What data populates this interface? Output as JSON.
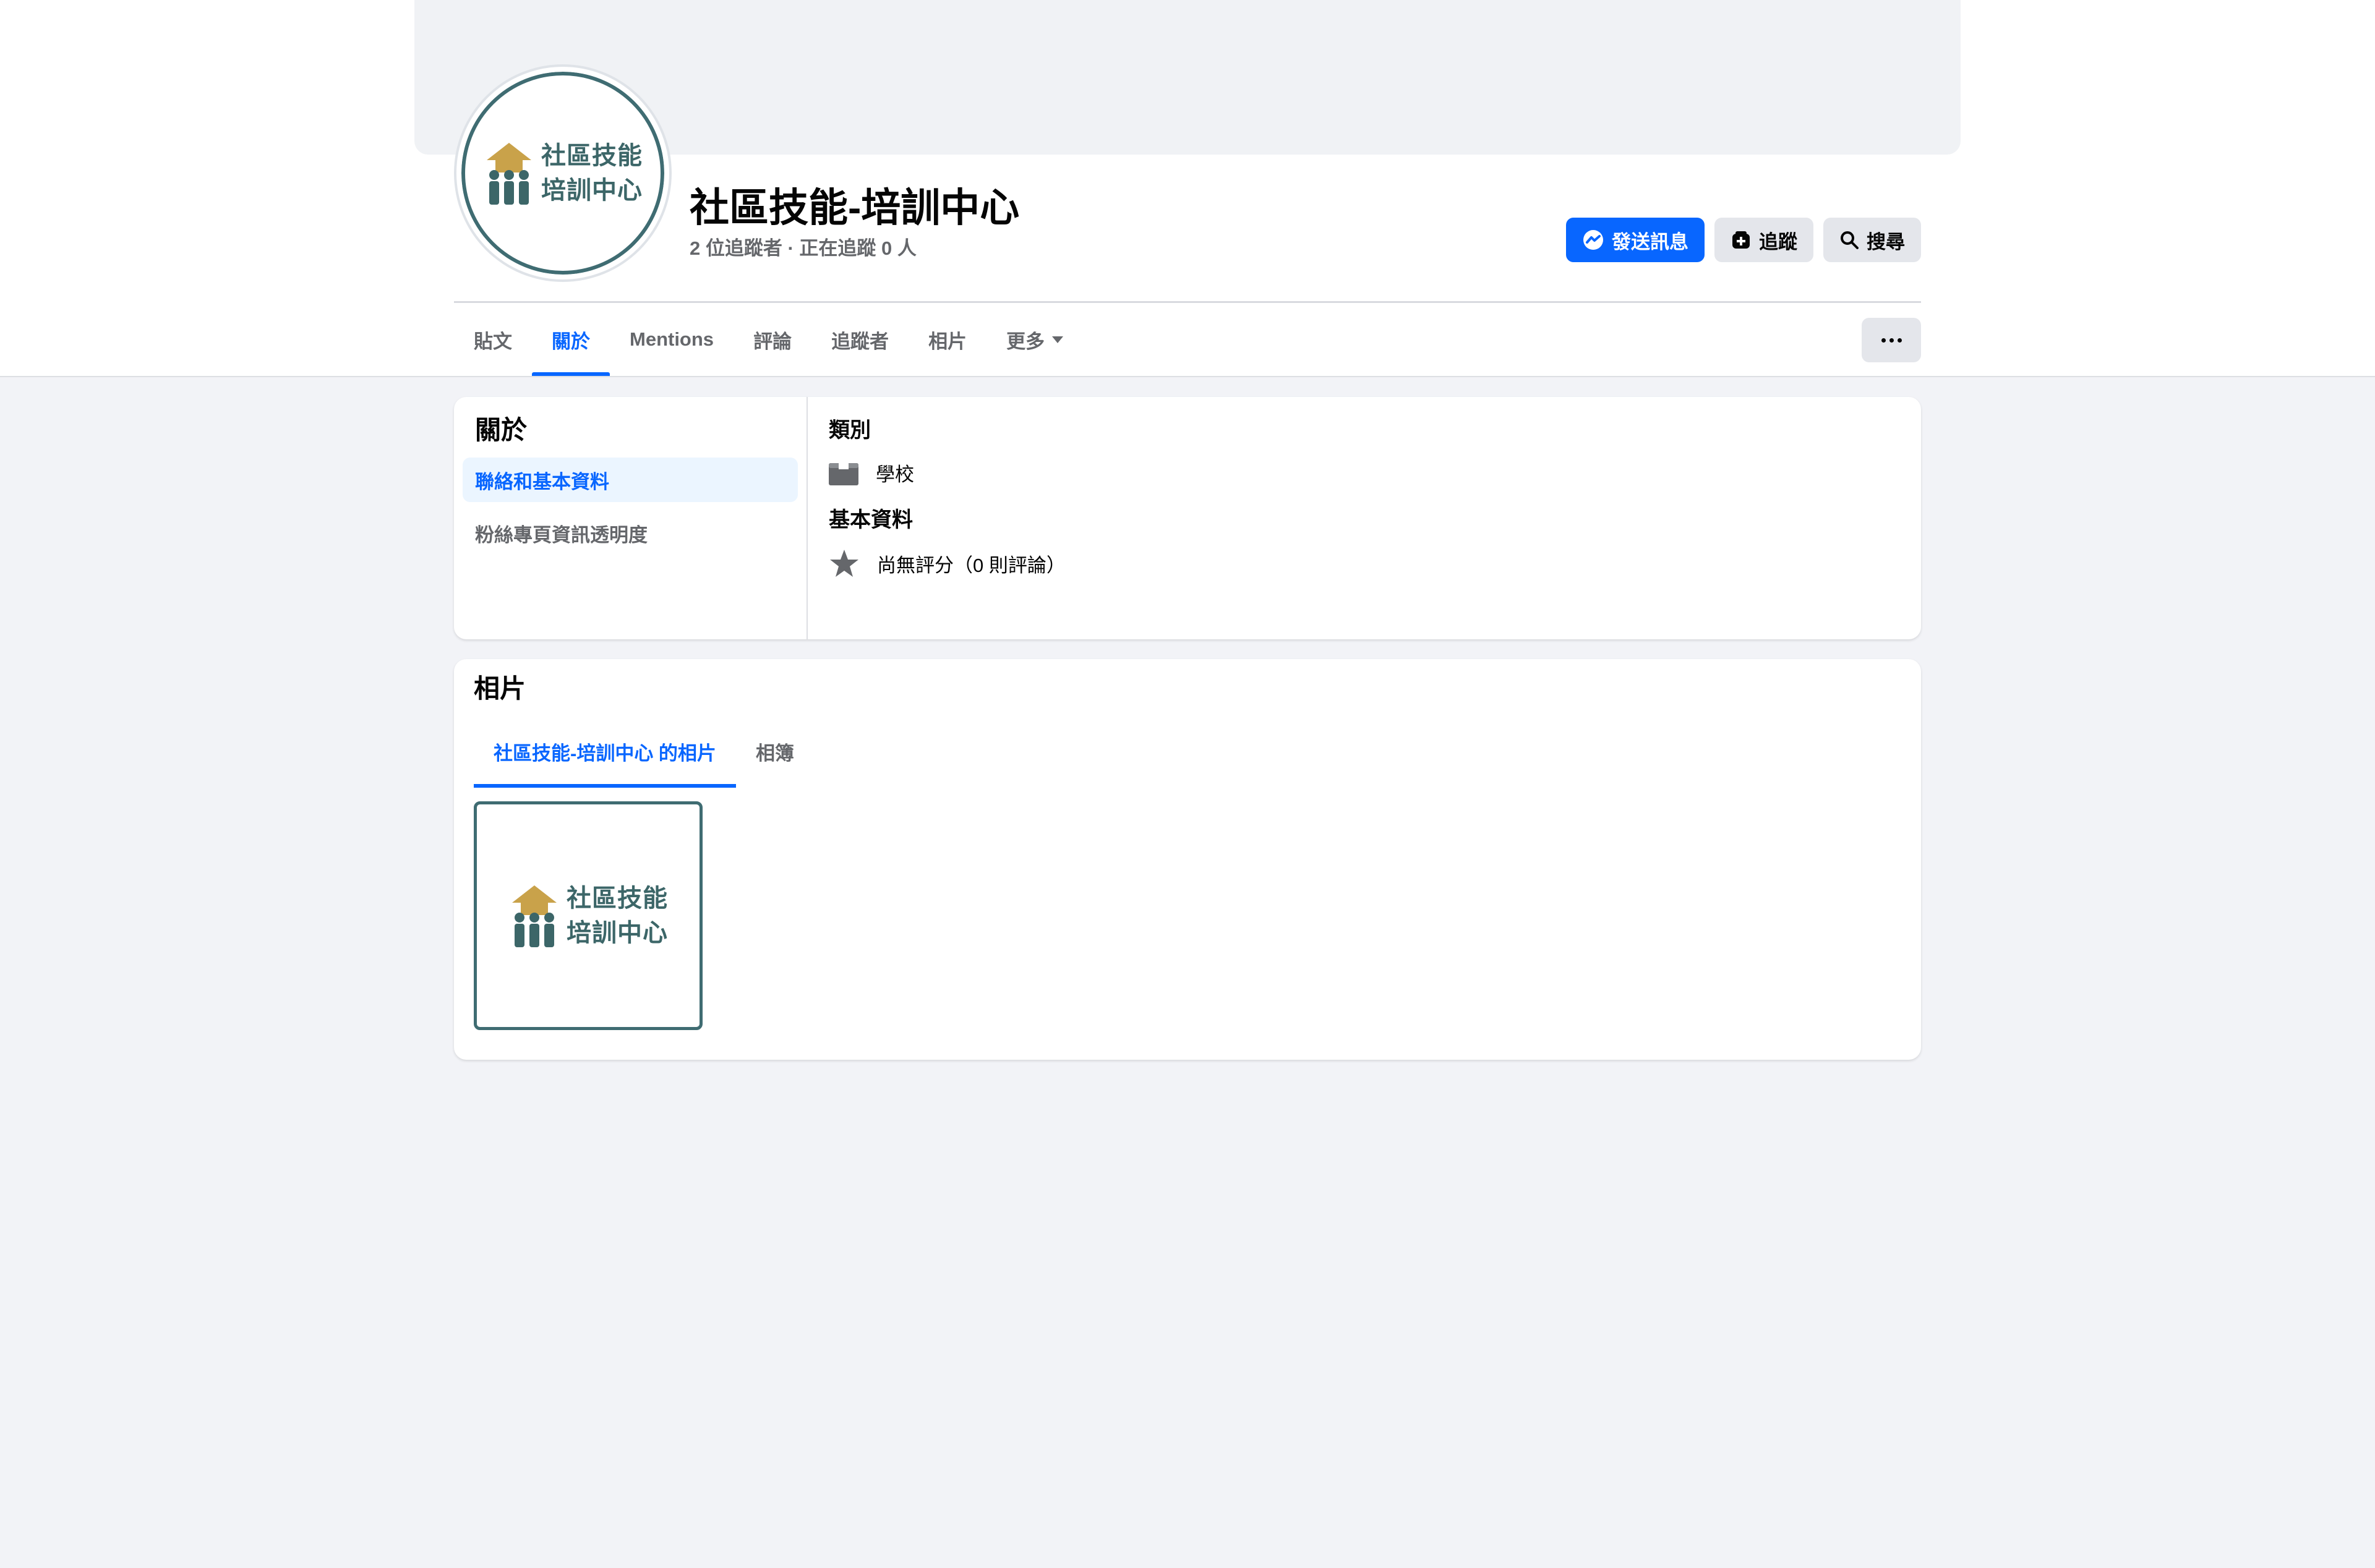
{
  "page": {
    "title": "社區技能-培訓中心",
    "followers": "2 位追蹤者 · 正在追蹤 0 人",
    "logo_lines": [
      "社區技能",
      "培訓中心"
    ]
  },
  "actions": {
    "message": "發送訊息",
    "follow": "追蹤",
    "search": "搜尋"
  },
  "tabs": [
    {
      "label": "貼文"
    },
    {
      "label": "關於"
    },
    {
      "label": "Mentions"
    },
    {
      "label": "評論"
    },
    {
      "label": "追蹤者"
    },
    {
      "label": "相片"
    },
    {
      "label": "更多"
    }
  ],
  "about": {
    "heading": "關於",
    "nav": [
      "聯絡和基本資料",
      "粉絲專頁資訊透明度"
    ],
    "category_title": "類別",
    "category_value": "學校",
    "basic_title": "基本資料",
    "rating_value": "尚無評分（0 則評論）"
  },
  "photos": {
    "heading": "相片",
    "tabs": [
      "社區技能-培訓中心 的相片",
      "相簿"
    ]
  },
  "colors": {
    "accent": "#0866ff",
    "logo": "#3c6668"
  }
}
